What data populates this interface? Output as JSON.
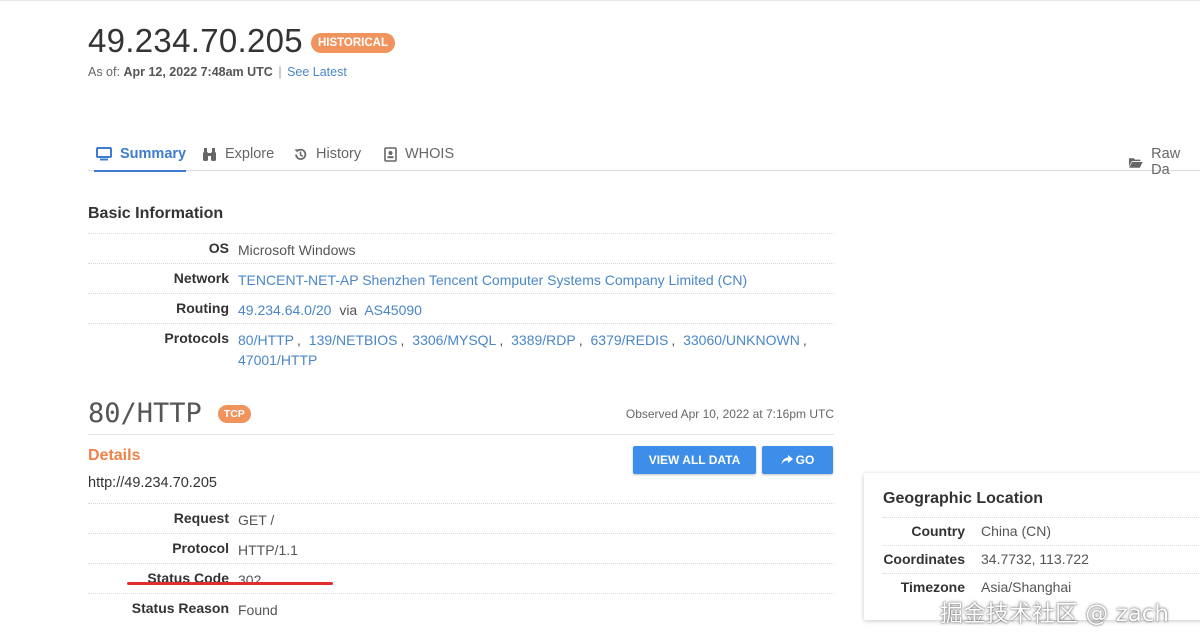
{
  "header": {
    "ip": "49.234.70.205",
    "badge": "HISTORICAL",
    "as_of_label": "As of:",
    "as_of_value": "Apr 12, 2022 7:48am UTC",
    "separator": "|",
    "see_latest": "See Latest"
  },
  "tabs": [
    {
      "label": "Summary",
      "icon": "monitor-icon",
      "active": true
    },
    {
      "label": "Explore",
      "icon": "binoculars-icon",
      "active": false
    },
    {
      "label": "History",
      "icon": "history-icon",
      "active": false
    },
    {
      "label": "WHOIS",
      "icon": "id-card-icon",
      "active": false
    },
    {
      "label": "Raw Da",
      "icon": "folder-open-icon",
      "active": false
    }
  ],
  "basic_info": {
    "title": "Basic Information",
    "os_label": "OS",
    "os_value": "Microsoft Windows",
    "network_label": "Network",
    "network_value": "TENCENT-NET-AP Shenzhen Tencent Computer Systems Company Limited (CN)",
    "routing_label": "Routing",
    "routing_prefix": "49.234.64.0/20",
    "routing_via": "via",
    "routing_as": "AS45090",
    "protocols_label": "Protocols",
    "protocols": [
      "80/HTTP",
      "139/NETBIOS",
      "3306/MYSQL",
      "3389/RDP",
      "6379/REDIS",
      "33060/UNKNOWN",
      "47001/HTTP"
    ],
    "comma": ","
  },
  "service": {
    "name": "80/HTTP",
    "badge": "TCP",
    "observed": "Observed Apr 10, 2022 at 7:16pm UTC",
    "details_label": "Details",
    "url": "http://49.234.70.205",
    "view_all": "VIEW ALL DATA",
    "go": "GO",
    "rows": {
      "request_label": "Request",
      "request_value": "GET /",
      "protocol_label": "Protocol",
      "protocol_value": "HTTP/1.1",
      "status_code_label": "Status Code",
      "status_code_value": "302",
      "status_reason_label": "Status Reason",
      "status_reason_value": "Found"
    }
  },
  "geo": {
    "title": "Geographic Location",
    "country_label": "Country",
    "country_value": "China (CN)",
    "coords_label": "Coordinates",
    "coords_value": "34.7732, 113.722",
    "timezone_label": "Timezone",
    "timezone_value": "Asia/Shanghai"
  },
  "watermark": "掘金技术社区 @ zach",
  "colors": {
    "accent": "#3f7bd0",
    "link": "#4a86c8",
    "badge": "#f0935d",
    "details": "#ef8248",
    "button": "#3d8ee8",
    "annotation": "#e02d2d"
  }
}
